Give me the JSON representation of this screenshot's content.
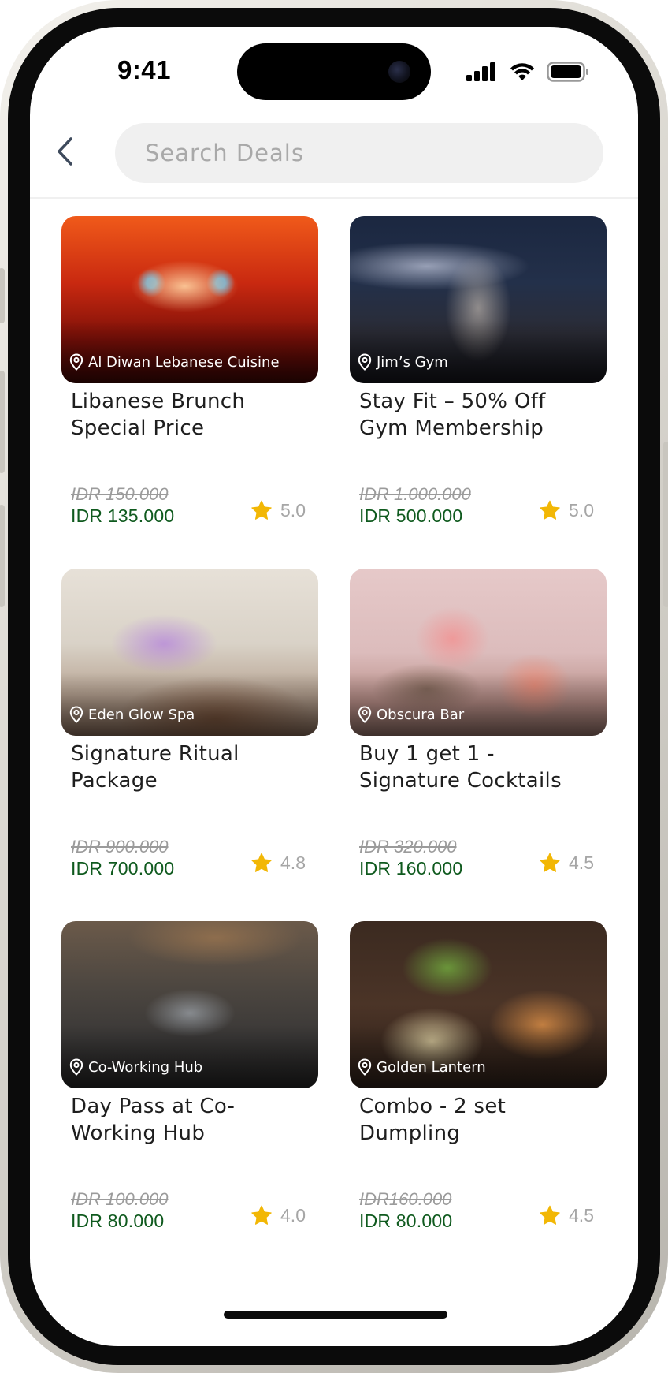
{
  "status_bar": {
    "time": "9:41"
  },
  "search": {
    "placeholder": "Search Deals"
  },
  "colors": {
    "price_green": "#0f5a1e",
    "star_yellow": "#f2b705",
    "muted_gray": "#a6a6a6"
  },
  "deals": [
    {
      "location": "Al Diwan Lebanese Cuisine",
      "title": "Libanese Brunch Special Price",
      "old_price": "IDR 150.000",
      "new_price": "IDR 135.000",
      "rating": "5.0"
    },
    {
      "location": "Jim’s Gym",
      "title": "Stay Fit – 50% Off Gym Membership",
      "old_price": "IDR 1.000.000",
      "new_price": "IDR 500.000",
      "rating": "5.0"
    },
    {
      "location": "Eden Glow Spa",
      "title": "Signature Ritual Package",
      "old_price": "IDR 900.000",
      "new_price": "IDR 700.000",
      "rating": "4.8"
    },
    {
      "location": "Obscura Bar",
      "title": "Buy 1 get 1 - Signature Cocktails",
      "old_price": "IDR 320.000",
      "new_price": "IDR 160.000",
      "rating": "4.5"
    },
    {
      "location": "Co-Working Hub",
      "title": "Day Pass at Co-Working Hub",
      "old_price": "IDR 100.000",
      "new_price": "IDR 80.000",
      "rating": "4.0"
    },
    {
      "location": "Golden Lantern",
      "title": "Combo - 2 set Dumpling",
      "old_price": "IDR160.000",
      "new_price": "IDR 80.000",
      "rating": "4.5"
    }
  ]
}
